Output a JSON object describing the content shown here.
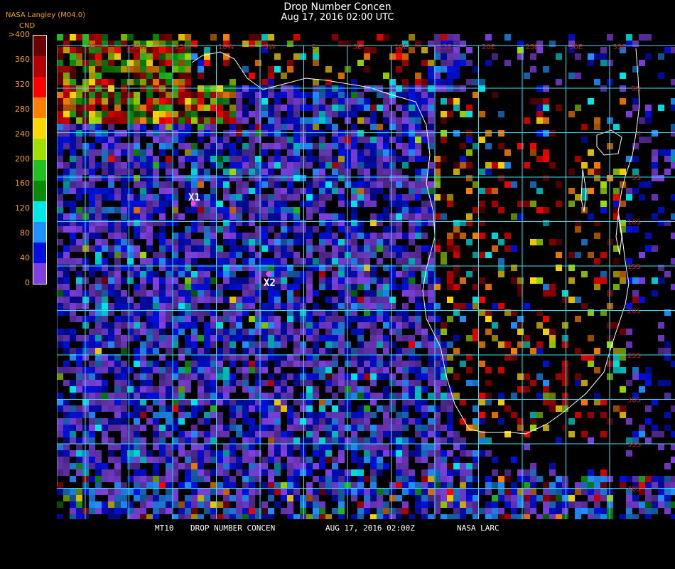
{
  "header": {
    "title": "Drop Number Concen",
    "datetime": "Aug 17, 2016 02:00 UTC",
    "organization": "NASA Langley (M04.0)",
    "unit": "CND"
  },
  "colorbar": {
    "ticks": [
      ">400",
      "360",
      "320",
      "280",
      "240",
      "200",
      "160",
      "120",
      "80",
      "40",
      "0"
    ],
    "colors": [
      "#6a0000",
      "#b40000",
      "#ff0000",
      "#ff8000",
      "#ffd800",
      "#a0e000",
      "#20c020",
      "#0a8a0a",
      "#00e8e8",
      "#2090ff",
      "#0010e0",
      "#8040e0"
    ]
  },
  "map": {
    "lon_labels": [
      "25W",
      "20W",
      "15W",
      "10W",
      "5W",
      "0",
      "5E",
      "10E",
      "15E",
      "20E",
      "25E",
      "30E",
      "35E"
    ],
    "lat_labels": [
      "5N",
      "0",
      "5S",
      "10S",
      "15S",
      "20S",
      "25S",
      "30S",
      "35S",
      "40S"
    ],
    "markers": [
      {
        "label": "X1",
        "color": "#ff40ff"
      },
      {
        "label": "X2",
        "color": "#ff40ff"
      }
    ],
    "colors": {
      "grid": "#40e0f0",
      "coast": "#ffffff",
      "lon_label": "#c02020",
      "lat_label": "#c02020"
    }
  },
  "footer": {
    "sat": "MT10",
    "product": "DROP NUMBER CONCEN",
    "date": "AUG 17, 2016 02:00Z",
    "org": "NASA LARC"
  }
}
